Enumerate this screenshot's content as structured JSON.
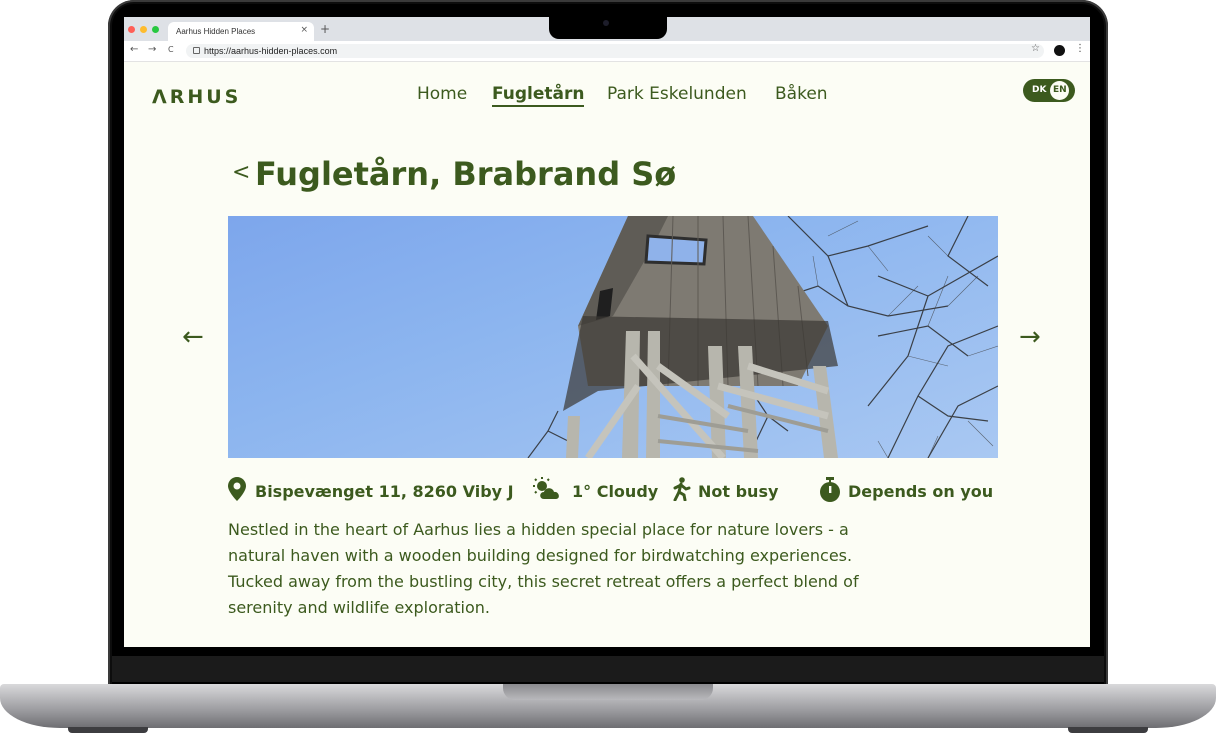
{
  "browser": {
    "tab_title": "Aarhus Hidden Places",
    "tab_close": "×",
    "new_tab": "+",
    "url": "https://aarhus-hidden-places.com",
    "back": "←",
    "forward": "→",
    "reload": "C",
    "star": "☆",
    "menu": "⋮"
  },
  "site": {
    "logo": "ΛRHUS",
    "nav": [
      {
        "label": "Home",
        "active": false
      },
      {
        "label": "Fugletårn",
        "active": true
      },
      {
        "label": "Park Eskelunden",
        "active": false
      },
      {
        "label": "Båken",
        "active": false
      }
    ],
    "language": {
      "dk": "DK",
      "en": "EN",
      "selected": "EN"
    },
    "accent_color": "#3c5a1e",
    "background_color": "#fcfdf5"
  },
  "place": {
    "back_chevron": "<",
    "title": "Fugletårn, Brabrand Sø",
    "prev_arrow": "←",
    "next_arrow": "→",
    "address": "Bispevænget 11, 8260 Viby J",
    "weather": "1° Cloudy",
    "crowd": "Not busy",
    "duration": "Depends on you",
    "icons": [
      "location-pin-icon",
      "partly-cloudy-icon",
      "walking-person-icon",
      "stopwatch-icon"
    ],
    "description": "Nestled in the heart of Aarhus lies a hidden special place for nature lovers - a natural haven with a wooden building designed for birdwatching experiences. Tucked away from the bustling city, this secret retreat offers a perfect blend of serenity and wildlife exploration."
  }
}
